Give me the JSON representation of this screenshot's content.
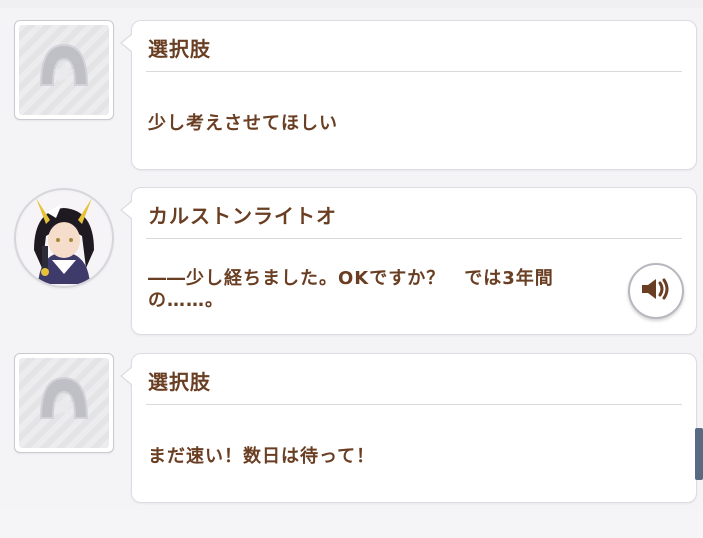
{
  "entries": [
    {
      "speaker": "選択肢",
      "message": "少し考えさせてほしい",
      "avatar": "placeholder-horseshoe-icon"
    },
    {
      "speaker": "カルストンライトオ",
      "message": "――少し経ちました。OKですか？　では3年間の……。",
      "avatar": "character-portrait",
      "voice_button": "speaker-sound-icon"
    },
    {
      "speaker": "選択肢",
      "message": "まだ速い！数日は待って！",
      "avatar": "placeholder-horseshoe-icon"
    }
  ],
  "colors": {
    "text_brown": "#6a3e22",
    "accent_slate": "#5a6a83",
    "card_bg": "#ffffff"
  }
}
